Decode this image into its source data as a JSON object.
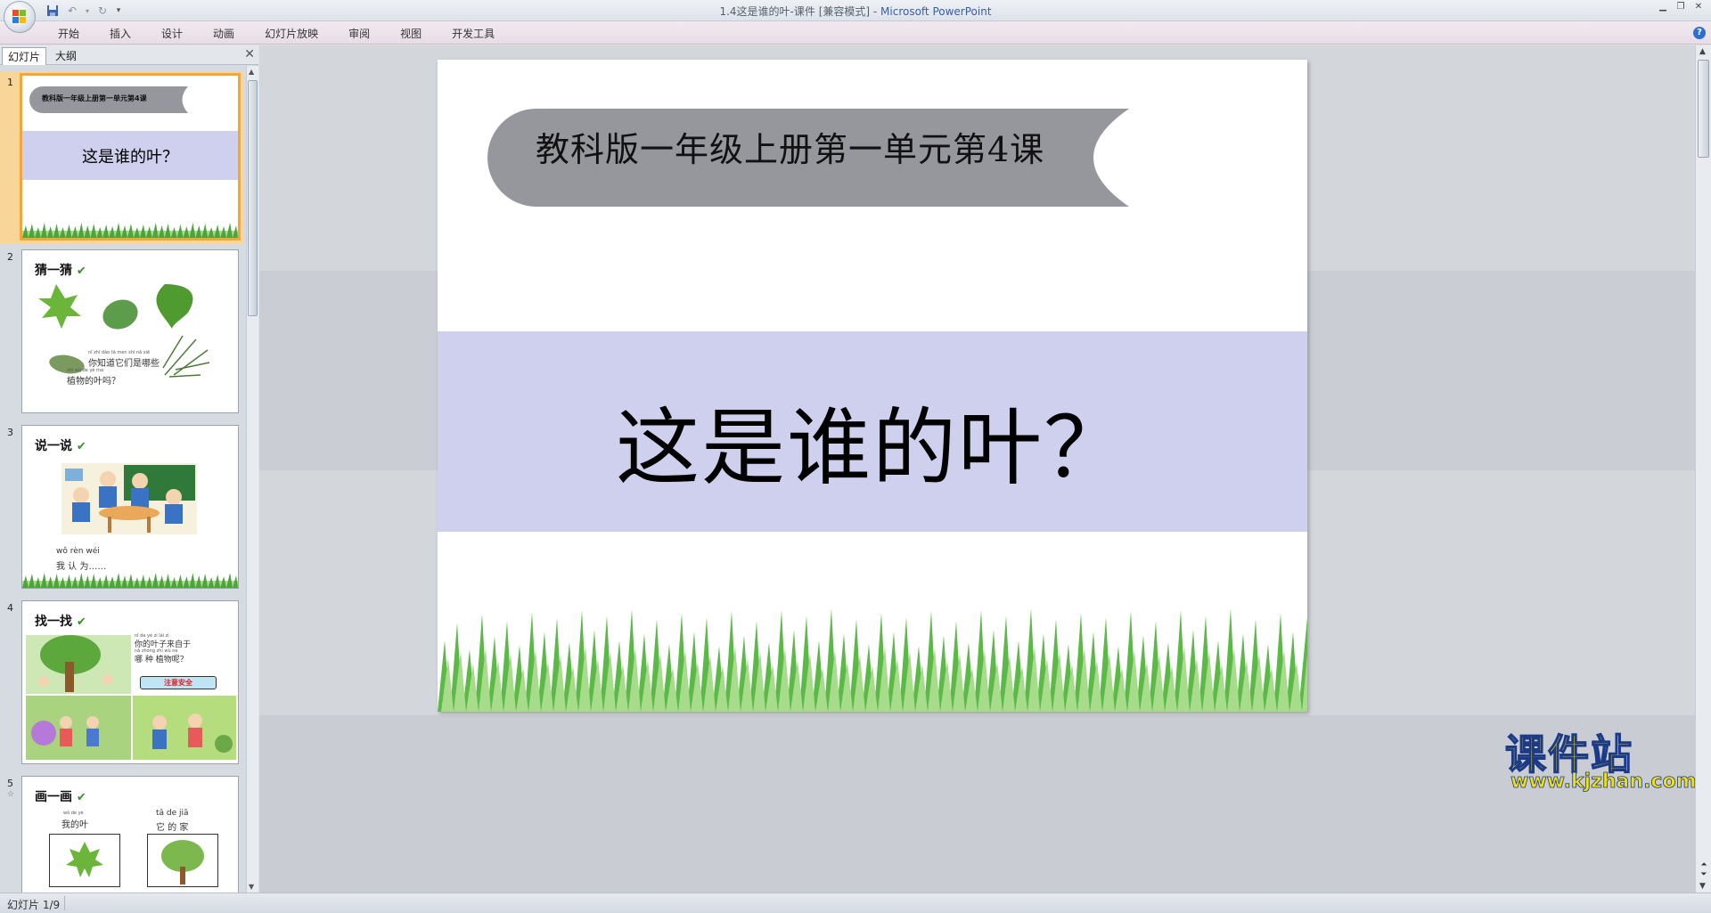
{
  "window": {
    "title": "1.4这是谁的叶-课件 [兼容模式] - ",
    "app_name": "Microsoft PowerPoint"
  },
  "ribbon": {
    "tabs": [
      "开始",
      "插入",
      "设计",
      "动画",
      "幻灯片放映",
      "审阅",
      "视图",
      "开发工具"
    ]
  },
  "left_pane": {
    "tabs": {
      "slides": "幻灯片",
      "outline": "大纲"
    },
    "thumbnails": [
      {
        "num": "1",
        "subtitle": "教科版一年级上册第一单元第4课",
        "title": "这是谁的叶？",
        "selected": true
      },
      {
        "num": "2",
        "title": "猜一猜",
        "pinyin": "nǐ zhī dào tā men shì nǎ xiē",
        "caption1": "你知道它们是哪些",
        "pinyin2": "zhí wù de yè ma",
        "caption2": "植物的叶吗？"
      },
      {
        "num": "3",
        "title": "说一说",
        "pinyin": "wǒ  rèn  wéi",
        "caption": "我  认  为……"
      },
      {
        "num": "4",
        "title": "找一找",
        "pinyin": "nǐ de yè zi lái zì",
        "caption1": "你的叶子来自于",
        "pinyin2": "nǎ zhǒng zhí wù ne",
        "caption2": "哪 种 植物呢？",
        "badge": "注意安全"
      },
      {
        "num": "5",
        "star": "☆",
        "title": "画一画",
        "left_pinyin": "wǒ de yè",
        "left_label": "我的叶",
        "right_pinyin": "tā de jiā",
        "right_label": "它 的 家"
      }
    ]
  },
  "slide": {
    "banner_text": "教科版一年级上册第一单元第4课",
    "main_title": "这是谁的叶？"
  },
  "watermark": {
    "name": "课件站",
    "url": "www.kjzhan.com"
  },
  "statusbar": {
    "slide_info": "幻灯片 1/9"
  },
  "colors": {
    "banner_gray": "#96979c",
    "title_band": "#cfcfee",
    "selection_orange": "#f3a63b",
    "grass_green": "#5db84a"
  }
}
